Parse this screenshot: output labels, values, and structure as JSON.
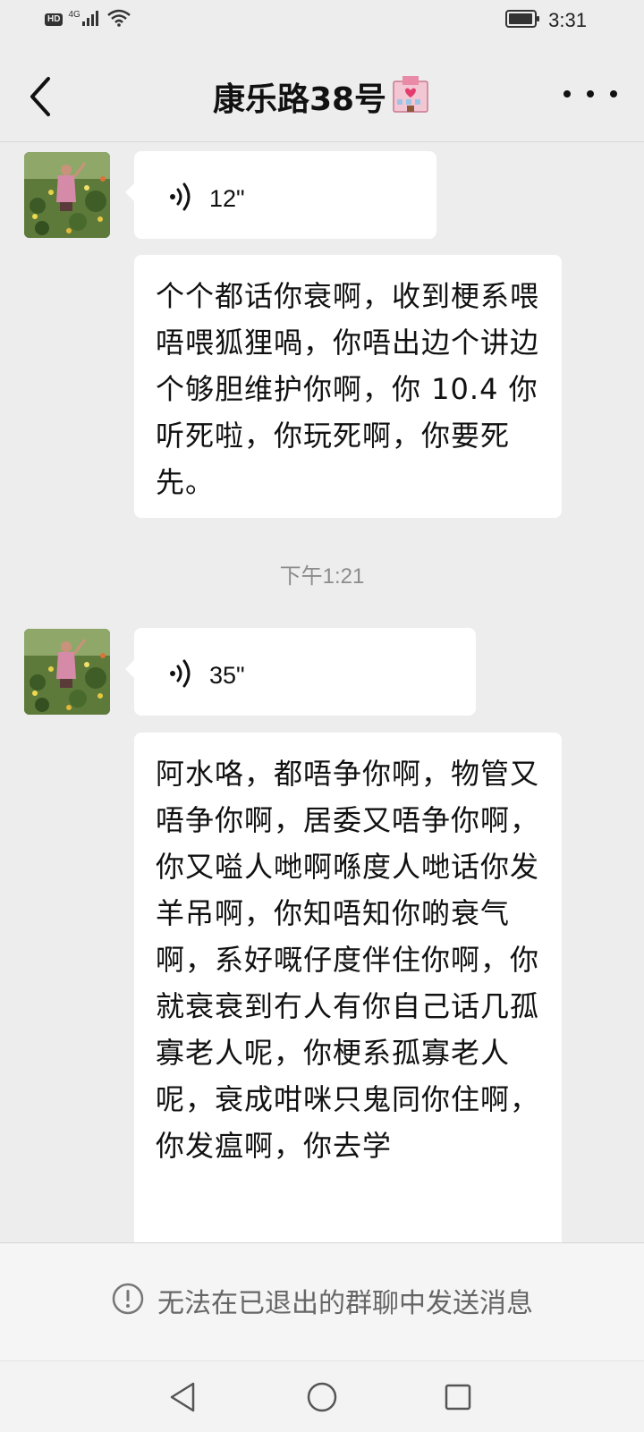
{
  "status_bar": {
    "hd_label": "HD",
    "network": "4G",
    "time": "3:31",
    "icons": [
      "signal-icon",
      "wifi-icon",
      "battery-icon"
    ]
  },
  "header": {
    "title": "康乐路38号",
    "title_emoji": "🏩",
    "back_icon": "back-chevron-icon",
    "more_icon": "more-dots-icon"
  },
  "messages": [
    {
      "type": "voice",
      "duration": "12\"",
      "icon": "voice-wave-icon"
    },
    {
      "type": "text",
      "text": "个个都话你衰啊，收到梗系喂唔喂狐狸喎，你唔出边个讲边个够胆维护你啊，你 10.4 你听死啦，你玩死啊，你要死先。"
    },
    {
      "type": "timestamp",
      "text": "下午1:21"
    },
    {
      "type": "voice",
      "duration": "35\"",
      "icon": "voice-wave-icon"
    },
    {
      "type": "text",
      "text": "阿水咯，都唔争你啊，物管又唔争你啊，居委又唔争你啊，你又嗌人哋啊喺度人哋话你发羊吊啊，你知唔知你啲衰气啊，系好嘅仔度伴住你啊，你就衰衰到冇人有你自己话几孤寡老人呢，你梗系孤寡老人呢，衰成咁咪只鬼同你住啊，你发瘟啊，你去学"
    }
  ],
  "notice": {
    "text": "无法在已退出的群聊中发送消息",
    "icon": "info-circle-icon"
  },
  "nav": {
    "back_icon": "nav-back-triangle-icon",
    "home_icon": "nav-home-circle-icon",
    "recents_icon": "nav-recents-square-icon"
  },
  "colors": {
    "background": "#ededed",
    "bubble": "#ffffff",
    "timestamp": "#8c8c8c",
    "notice_text": "#666666"
  }
}
